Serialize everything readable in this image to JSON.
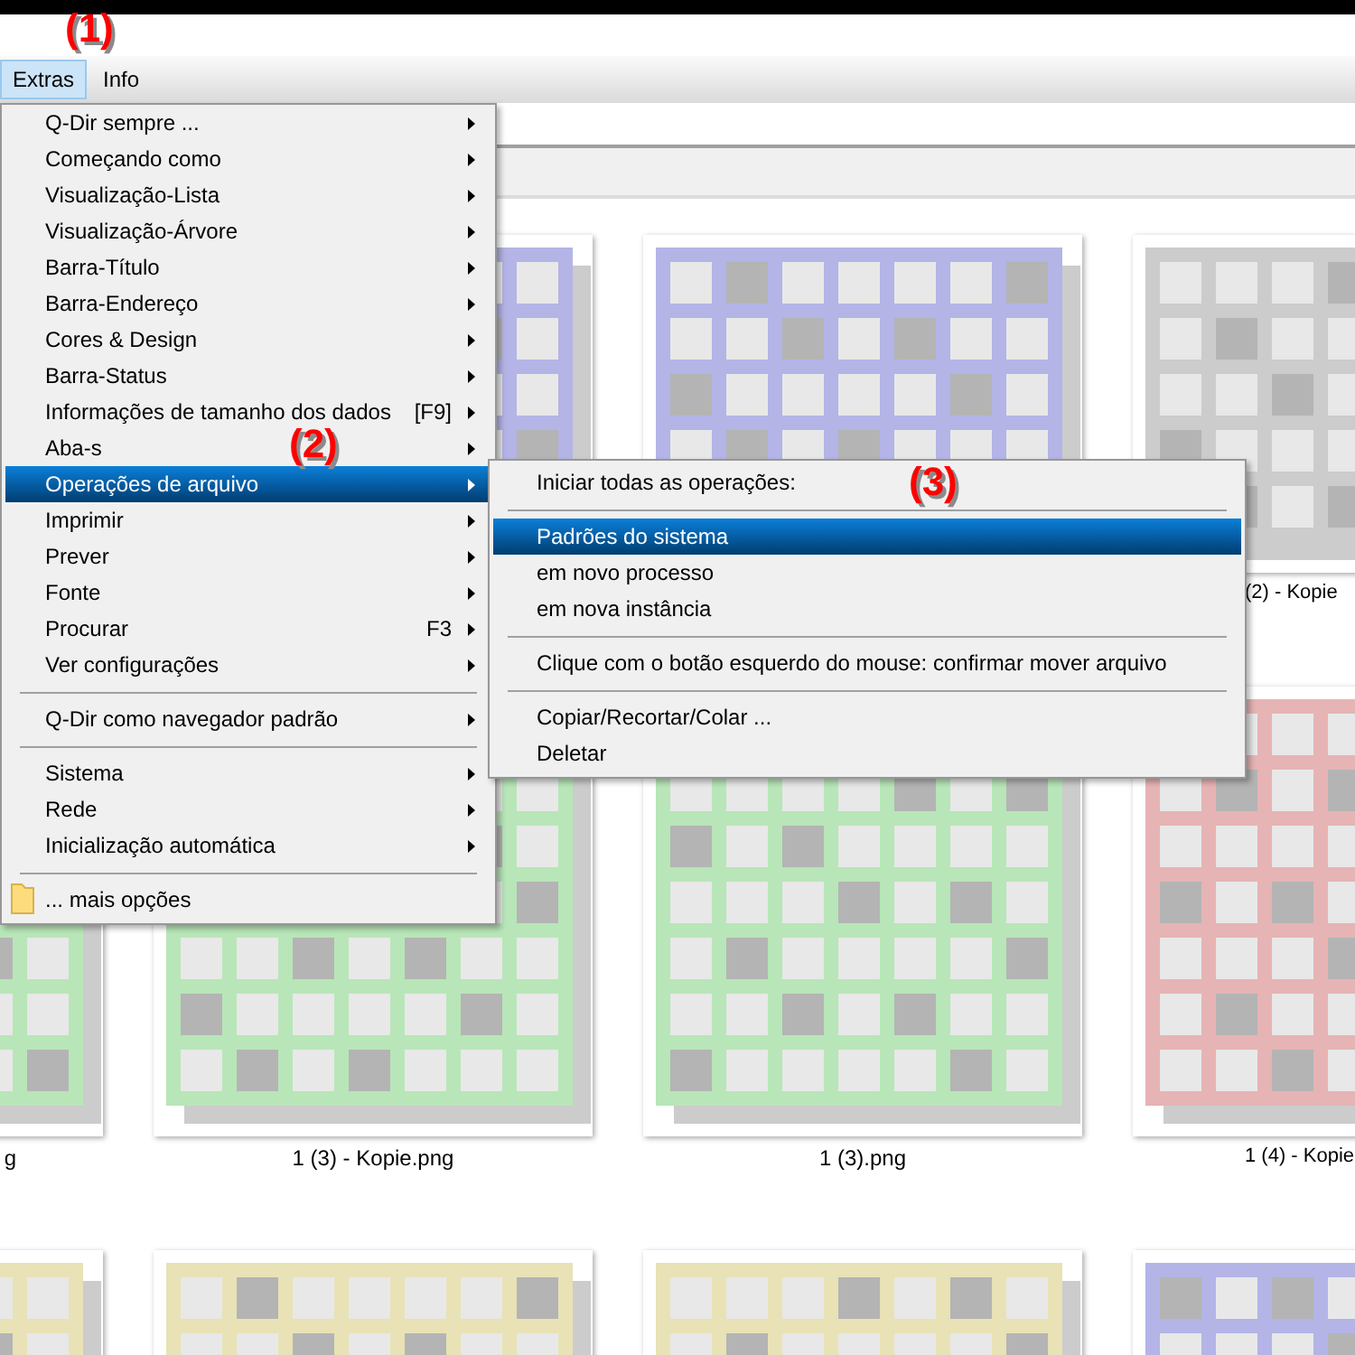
{
  "annotations": [
    {
      "text": "(1)"
    },
    {
      "text": "(2)"
    },
    {
      "text": "(3)"
    }
  ],
  "menu_bar": [
    {
      "label": "Extras",
      "selected": true
    },
    {
      "label": "Info",
      "selected": false
    }
  ],
  "extras_menu": {
    "items": [
      {
        "kind": "item",
        "label": "Q-Dir sempre ...",
        "submenu": true,
        "selected": false
      },
      {
        "kind": "item",
        "label": "Começando como",
        "submenu": true,
        "selected": false
      },
      {
        "kind": "item",
        "label": "Visualização-Lista",
        "submenu": true,
        "selected": false
      },
      {
        "kind": "item",
        "label": "Visualização-Árvore",
        "submenu": true,
        "selected": false
      },
      {
        "kind": "item",
        "label": "Barra-Título",
        "submenu": true,
        "selected": false
      },
      {
        "kind": "item",
        "label": "Barra-Endereço",
        "submenu": true,
        "selected": false
      },
      {
        "kind": "item",
        "label": "Cores & Design",
        "submenu": true,
        "selected": false
      },
      {
        "kind": "item",
        "label": "Barra-Status",
        "submenu": true,
        "selected": false
      },
      {
        "kind": "item",
        "label": "Informações de tamanho dos dados",
        "shortcut": "[F9]",
        "submenu": true,
        "selected": false
      },
      {
        "kind": "item",
        "label": "Aba-s",
        "submenu": true,
        "selected": false
      },
      {
        "kind": "item",
        "label": "Operações de arquivo",
        "submenu": true,
        "selected": true
      },
      {
        "kind": "item",
        "label": "Imprimir",
        "submenu": true,
        "selected": false
      },
      {
        "kind": "item",
        "label": "Prever",
        "submenu": true,
        "selected": false
      },
      {
        "kind": "item",
        "label": "Fonte",
        "submenu": true,
        "selected": false
      },
      {
        "kind": "item",
        "label": "Procurar",
        "shortcut": "F3",
        "submenu": true,
        "selected": false
      },
      {
        "kind": "item",
        "label": "Ver configurações",
        "submenu": true,
        "selected": false
      },
      {
        "kind": "separator"
      },
      {
        "kind": "item",
        "label": "Q-Dir como navegador padrão",
        "submenu": true,
        "selected": false
      },
      {
        "kind": "separator"
      },
      {
        "kind": "item",
        "label": "Sistema",
        "submenu": true,
        "selected": false
      },
      {
        "kind": "item",
        "label": "Rede",
        "submenu": true,
        "selected": false
      },
      {
        "kind": "item",
        "label": "Inicialização automática",
        "submenu": true,
        "selected": false
      },
      {
        "kind": "separator"
      },
      {
        "kind": "icon_item",
        "label": "... mais opções",
        "submenu": false,
        "selected": false
      }
    ]
  },
  "file_operations_submenu": {
    "items": [
      {
        "kind": "item",
        "label": "Iniciar todas as operações:",
        "submenu": false,
        "selected": false
      },
      {
        "kind": "separator"
      },
      {
        "kind": "item",
        "label": "Padrões do sistema",
        "submenu": false,
        "selected": true
      },
      {
        "kind": "item",
        "label": "em novo processo",
        "submenu": false,
        "selected": false
      },
      {
        "kind": "item",
        "label": "em nova instância",
        "submenu": false,
        "selected": false
      },
      {
        "kind": "separator"
      },
      {
        "kind": "item",
        "label": "Clique com o botão esquerdo do mouse: confirmar mover arquivo",
        "submenu": false,
        "selected": false
      },
      {
        "kind": "separator"
      },
      {
        "kind": "item",
        "label": "Copiar/Recortar/Colar ...",
        "submenu": false,
        "selected": false
      },
      {
        "kind": "item",
        "label": "Deletar",
        "submenu": false,
        "selected": false
      }
    ]
  },
  "thumbnails": [
    {
      "kind": "covered"
    },
    {
      "kind": "image",
      "color": "#b4b4e6"
    },
    {
      "kind": "image",
      "color": "#b4b4e6"
    },
    {
      "kind": "image",
      "color": "#cccccc",
      "label": "(2) - Kopie"
    },
    {
      "kind": "image",
      "color": "#b8e6b8",
      "label": "g"
    },
    {
      "kind": "image",
      "color": "#b8e6b8",
      "label": "1 (3) - Kopie.png"
    },
    {
      "kind": "image",
      "color": "#b8e6b8",
      "label": "1 (3).png"
    },
    {
      "kind": "image",
      "color": "#e6b4b4",
      "label": "1 (4) - Kopie"
    },
    {
      "kind": "image",
      "color": "#e8e2b6"
    },
    {
      "kind": "image",
      "color": "#e8e2b6"
    },
    {
      "kind": "image",
      "color": "#e8e2b6"
    },
    {
      "kind": "image",
      "color": "#b4b4e6"
    }
  ]
}
